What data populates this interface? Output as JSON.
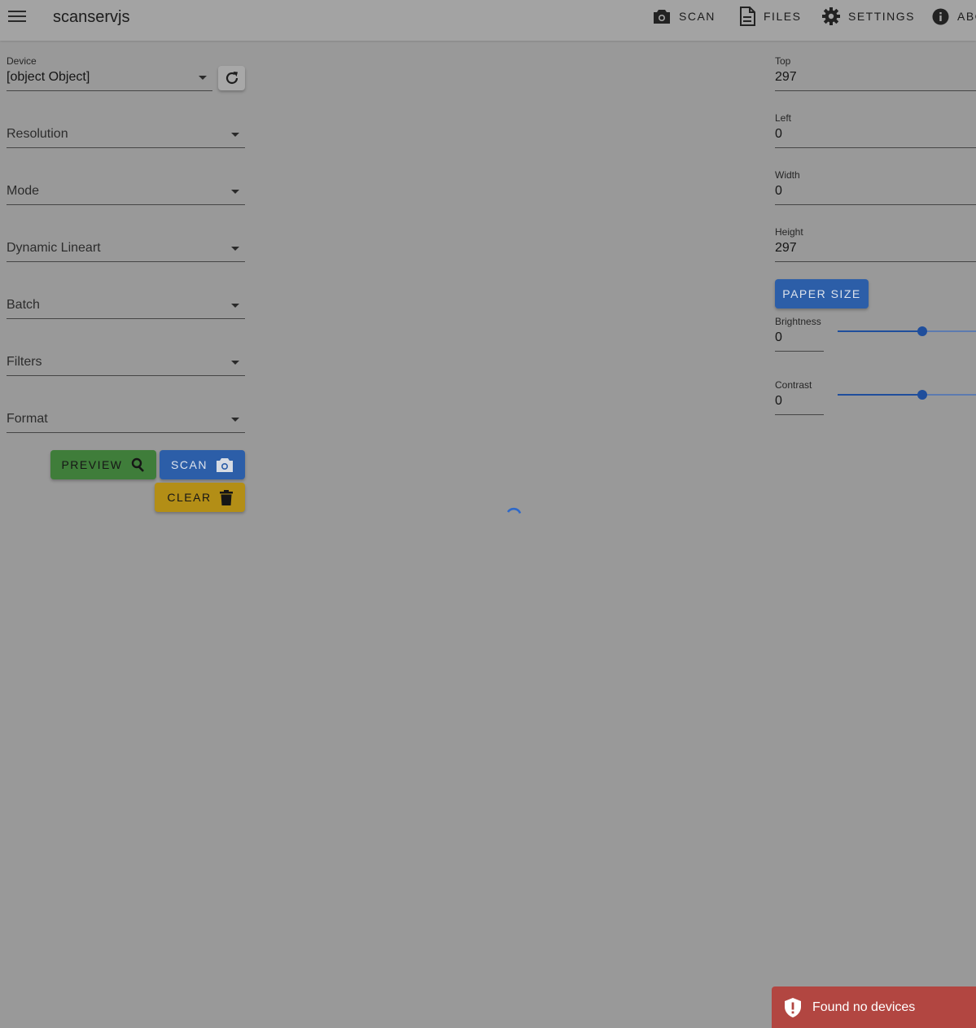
{
  "app": {
    "title": "scanservjs"
  },
  "nav": {
    "scan": "SCAN",
    "files": "FILES",
    "settings": "SETTINGS",
    "about": "ABOUT"
  },
  "left": {
    "device_label": "Device",
    "device_value": "[object Object]",
    "resolution": "Resolution",
    "mode": "Mode",
    "dynamic_lineart": "Dynamic Lineart",
    "batch": "Batch",
    "filters": "Filters",
    "format": "Format"
  },
  "buttons": {
    "preview": "PREVIEW",
    "scan": "SCAN",
    "clear": "CLEAR",
    "paper_size": "PAPER SIZE"
  },
  "right": {
    "top_label": "Top",
    "top_value": "297",
    "left_label": "Left",
    "left_value": "0",
    "width_label": "Width",
    "width_value": "0",
    "height_label": "Height",
    "height_value": "297",
    "brightness_label": "Brightness",
    "brightness_value": "0",
    "contrast_label": "Contrast",
    "contrast_value": "0"
  },
  "snackbar": {
    "message": "Found no devices"
  },
  "colors": {
    "preview": "#3f7d3a",
    "scan": "#2c5ea8",
    "clear": "#b38e16",
    "paper": "#2c5ea8",
    "error": "#b24641",
    "slider": "#1f4e9c"
  }
}
